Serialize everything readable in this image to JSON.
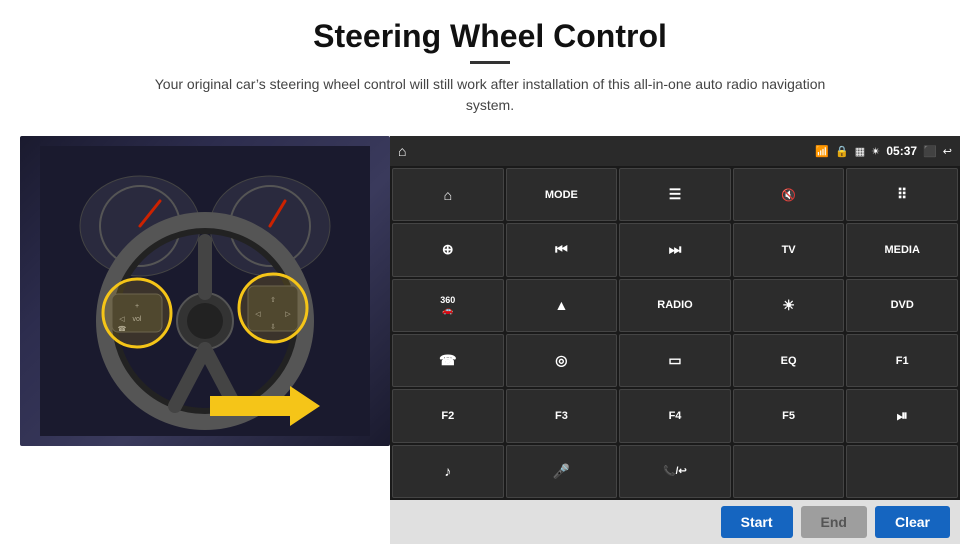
{
  "header": {
    "title": "Steering Wheel Control",
    "subtitle": "Your original car’s steering wheel control will still work after installation of this all-in-one auto radio navigation system."
  },
  "status_bar": {
    "time": "05:37",
    "icons": [
      "wifi",
      "lock",
      "sim",
      "bluetooth",
      "battery",
      "cast",
      "back"
    ]
  },
  "button_grid": [
    {
      "id": "r1c1",
      "label": "",
      "icon": "⌂",
      "type": "home"
    },
    {
      "id": "r1c2",
      "label": "MODE",
      "icon": ""
    },
    {
      "id": "r1c3",
      "label": "",
      "icon": "☰"
    },
    {
      "id": "r1c4",
      "label": "",
      "icon": "🔇"
    },
    {
      "id": "r1c5",
      "label": "",
      "icon": "⠿"
    },
    {
      "id": "r2c1",
      "label": "",
      "icon": "⊕"
    },
    {
      "id": "r2c2",
      "label": "",
      "icon": "⏮"
    },
    {
      "id": "r2c3",
      "label": "",
      "icon": "⏭"
    },
    {
      "id": "r2c4",
      "label": "TV",
      "icon": ""
    },
    {
      "id": "r2c5",
      "label": "MEDIA",
      "icon": ""
    },
    {
      "id": "r3c1",
      "label": "360",
      "icon": ""
    },
    {
      "id": "r3c2",
      "label": "",
      "icon": "▲"
    },
    {
      "id": "r3c3",
      "label": "RADIO",
      "icon": ""
    },
    {
      "id": "r3c4",
      "label": "",
      "icon": "☀"
    },
    {
      "id": "r3c5",
      "label": "DVD",
      "icon": ""
    },
    {
      "id": "r4c1",
      "label": "",
      "icon": "☎"
    },
    {
      "id": "r4c2",
      "label": "",
      "icon": "◎"
    },
    {
      "id": "r4c3",
      "label": "",
      "icon": "▭"
    },
    {
      "id": "r4c4",
      "label": "EQ",
      "icon": ""
    },
    {
      "id": "r4c5",
      "label": "F1",
      "icon": ""
    },
    {
      "id": "r5c1",
      "label": "F2",
      "icon": ""
    },
    {
      "id": "r5c2",
      "label": "F3",
      "icon": ""
    },
    {
      "id": "r5c3",
      "label": "F4",
      "icon": ""
    },
    {
      "id": "r5c4",
      "label": "F5",
      "icon": ""
    },
    {
      "id": "r5c5",
      "label": "",
      "icon": "⏯"
    },
    {
      "id": "r6c1",
      "label": "",
      "icon": "♪"
    },
    {
      "id": "r6c2",
      "label": "",
      "icon": "🎤"
    },
    {
      "id": "r6c3",
      "label": "",
      "icon": "📞"
    },
    {
      "id": "r6c4",
      "label": "",
      "icon": ""
    },
    {
      "id": "r6c5",
      "label": "",
      "icon": ""
    }
  ],
  "bottom_bar": {
    "start_label": "Start",
    "end_label": "End",
    "clear_label": "Clear"
  }
}
